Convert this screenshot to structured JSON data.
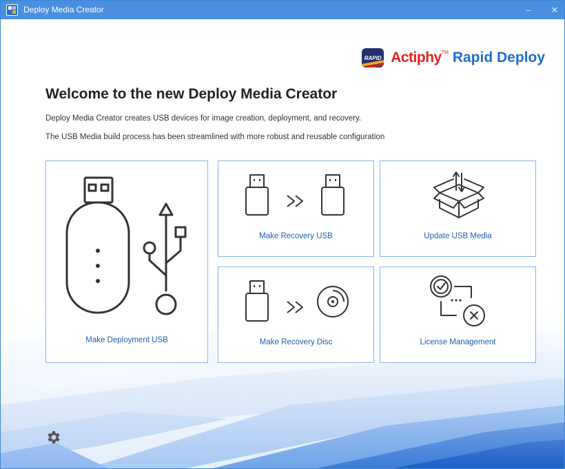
{
  "window": {
    "title": "Deploy Media Creator",
    "minimize_glyph": "–",
    "close_glyph": "✕"
  },
  "brand": {
    "logo_text": "RAPID",
    "name_part1": "Actiphy",
    "trademark": "TM",
    "name_part2": "Rapid Deploy"
  },
  "main": {
    "heading": "Welcome to the new Deploy Media Creator",
    "description_1": "Deploy Media Creator creates USB devices for image creation, deployment, and recovery.",
    "description_2": "The USB Media build process has been streamlined with more robust and reusable configuration"
  },
  "cards": {
    "deployment_usb": {
      "label": "Make Deployment USB",
      "icon": "usb-drive-icon"
    },
    "recovery_usb": {
      "label": "Make Recovery USB",
      "icon": "usb-to-usb-icon"
    },
    "update_usb": {
      "label": "Update USB Media",
      "icon": "open-box-icon"
    },
    "recovery_disc": {
      "label": "Make Recovery Disc",
      "icon": "usb-to-disc-icon"
    },
    "license": {
      "label": "License Management",
      "icon": "license-icon"
    }
  },
  "footer": {
    "settings_icon": "gear-icon"
  },
  "colors": {
    "titlebar": "#4a8fe0",
    "card_border": "#8ab4ea",
    "card_label": "#1f5fae",
    "brand_red": "#e2231a",
    "brand_blue": "#1e6fd0"
  }
}
